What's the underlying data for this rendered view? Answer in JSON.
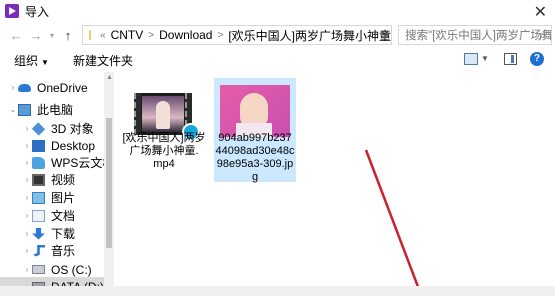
{
  "window": {
    "title": "导入"
  },
  "address": {
    "crumbs": [
      "CNTV",
      "Download",
      "[欢乐中国人]两岁广场舞小神童"
    ],
    "prefix": "«"
  },
  "search": {
    "placeholder": "搜索\"[欢乐中国人]两岁广场舞小...\""
  },
  "toolbar": {
    "organize": "组织",
    "new_folder": "新建文件夹"
  },
  "sidebar": {
    "items": [
      {
        "label": "OneDrive"
      },
      {
        "label": "此电脑"
      },
      {
        "label": "3D 对象"
      },
      {
        "label": "Desktop"
      },
      {
        "label": "WPS云文档"
      },
      {
        "label": "视频"
      },
      {
        "label": "图片"
      },
      {
        "label": "文档"
      },
      {
        "label": "下载"
      },
      {
        "label": "音乐"
      },
      {
        "label": "OS (C:)"
      },
      {
        "label": "DATA (D:)"
      }
    ]
  },
  "files": [
    {
      "name_lines": [
        "[欢乐中国人]两岁",
        "广场舞小神童.",
        "mp4"
      ]
    },
    {
      "name_lines": [
        "904ab997b237",
        "44098ad30e48c",
        "98e95a3-309.jp",
        "g"
      ]
    }
  ],
  "colors": {
    "selection": "#cce8ff",
    "accent": "#1e6fd0",
    "annotation_arrow": "#c8232c"
  }
}
